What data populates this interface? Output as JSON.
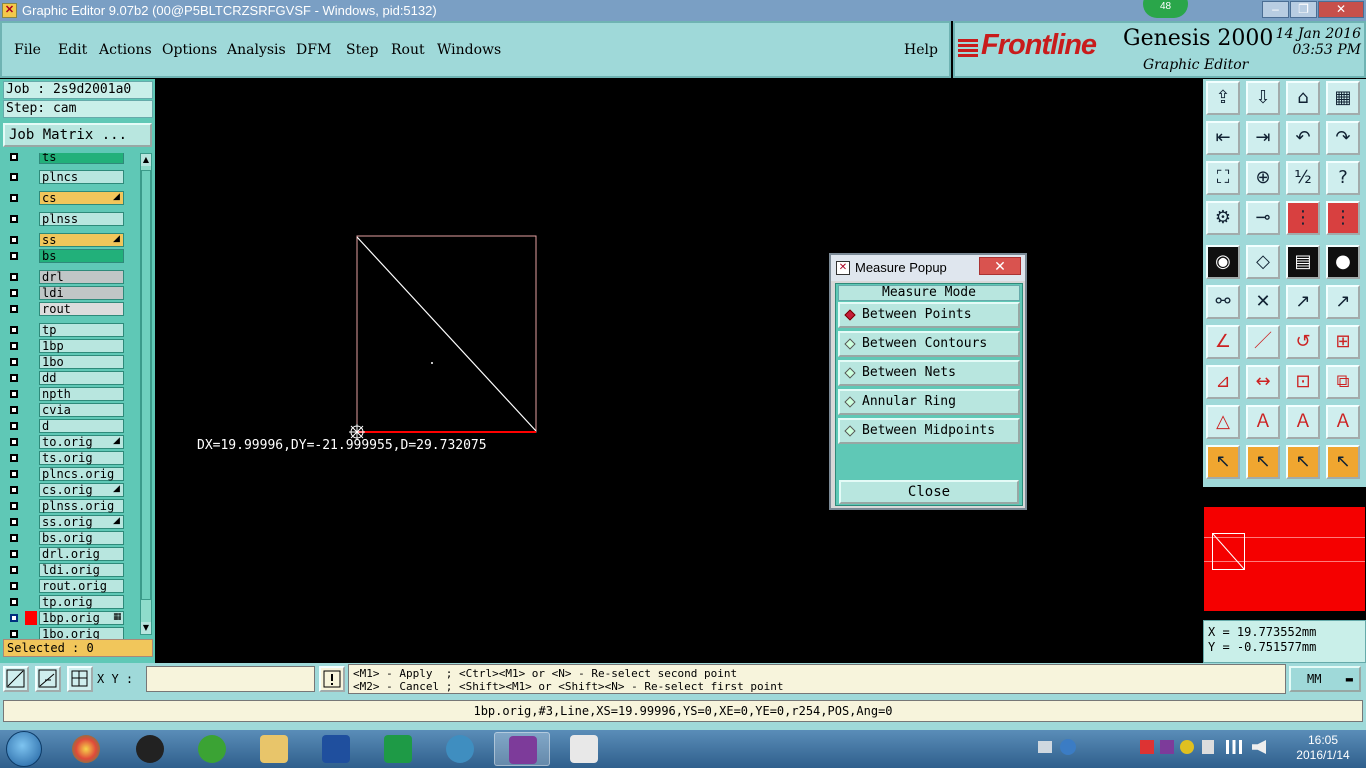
{
  "window": {
    "title": "Graphic Editor 9.07b2 (00@P5BLTCRZSRFGVSF - Windows, pid:5132)",
    "badge": "48",
    "controls": [
      "–",
      "❐",
      "✕"
    ]
  },
  "menu": {
    "items": [
      "File",
      "Edit",
      "Actions",
      "Options",
      "Analysis",
      "DFM",
      "Step",
      "Rout",
      "Windows"
    ],
    "help": "Help"
  },
  "brand": {
    "logo": "Frontline",
    "product": "Genesis 2000",
    "subtitle": "Graphic Editor",
    "date": "14 Jan 2016",
    "time": "03:53 PM"
  },
  "job": {
    "job_line": "Job : 2s9d2001a0",
    "step_line": "Step: cam",
    "matrix_button": "Job Matrix ...",
    "selected": "Selected : 0"
  },
  "layers": [
    {
      "name": "ts",
      "color": "#22b07a"
    },
    {
      "name": "plncs",
      "color": "#b8e6df"
    },
    {
      "name": "cs",
      "color": "#f1c65b"
    },
    {
      "name": "plnss",
      "color": "#b8e6df"
    },
    {
      "name": "ss",
      "color": "#f1c65b"
    },
    {
      "name": "bs",
      "color": "#22b07a"
    },
    {
      "name": "drl",
      "color": "#c0c6c6"
    },
    {
      "name": "ldi",
      "color": "#c0c6c6"
    },
    {
      "name": "rout",
      "color": "#dcdcdc"
    },
    {
      "name": "tp",
      "color": "#b8e6df"
    },
    {
      "name": "1bp",
      "color": "#b8e6df"
    },
    {
      "name": "1bo",
      "color": "#b8e6df"
    },
    {
      "name": "dd",
      "color": "#b8e6df"
    },
    {
      "name": "npth",
      "color": "#b8e6df"
    },
    {
      "name": "cvia",
      "color": "#b8e6df"
    },
    {
      "name": "d",
      "color": "#b8e6df"
    },
    {
      "name": "to.orig",
      "color": "#b8e6df"
    },
    {
      "name": "ts.orig",
      "color": "#b8e6df"
    },
    {
      "name": "plncs.orig",
      "color": "#b8e6df"
    },
    {
      "name": "cs.orig",
      "color": "#b8e6df"
    },
    {
      "name": "plnss.orig",
      "color": "#b8e6df"
    },
    {
      "name": "ss.orig",
      "color": "#b8e6df"
    },
    {
      "name": "bs.orig",
      "color": "#b8e6df"
    },
    {
      "name": "drl.orig",
      "color": "#b8e6df"
    },
    {
      "name": "ldi.orig",
      "color": "#b8e6df"
    },
    {
      "name": "rout.orig",
      "color": "#b8e6df"
    },
    {
      "name": "tp.orig",
      "color": "#b8e6df"
    },
    {
      "name": "1bp.orig",
      "color": "#b8e6df"
    },
    {
      "name": "1bo.orig",
      "color": "#b8e6df"
    }
  ],
  "canvas": {
    "measure_readout": "DX=19.99996,DY=-21.999955,D=29.732075"
  },
  "measure_popup": {
    "title": "Measure Popup",
    "close_x": "✕",
    "mode_header": "Measure Mode",
    "modes": [
      "Between Points",
      "Between Contours",
      "Between Nets",
      "Annular Ring",
      "Between Midpoints"
    ],
    "selected_mode": "Between Points",
    "close_button": "Close"
  },
  "toolbar": {
    "icons": [
      "open-step-icon",
      "save-icon",
      "home-icon",
      "panel-icon",
      "prev-icon",
      "next-icon",
      "undo-icon",
      "redo-icon",
      "zoom-fit-icon",
      "zoom-home-icon",
      "zoom-1to2-icon",
      "help-icon",
      "settings-icon",
      "snap-icon",
      "layers-a-icon",
      "layers-b-icon",
      "pad-icon",
      "rect-icon",
      "ruler-icon",
      "dot-icon",
      "connect-icon",
      "intersect-icon",
      "point-icon",
      "vector-icon",
      "angle-icon",
      "line-icon",
      "arc-icon",
      "fill-icon",
      "rotate-icon",
      "mirror-icon",
      "scale-icon",
      "copy-icon",
      "triangle-icon",
      "text-a-icon",
      "text-b-icon",
      "text-c-icon",
      "select-icon",
      "select-box-icon",
      "select-circle-icon",
      "select-poly-icon"
    ]
  },
  "cursor_coords": {
    "x": "X = 19.773552mm",
    "y": "Y = -0.751577mm"
  },
  "bottom": {
    "xy_label": "X Y :",
    "xy_value": "",
    "hint_line1": "<M1> - Apply  ; <Ctrl><M1> or <N> - Re-select second point",
    "hint_line2": "<M2> - Cancel ; <Shift><M1> or <Shift><N> - Re-select first point",
    "units": "MM",
    "status": "1bp.orig,#3,Line,XS=19.99996,YS=0,XE=0,YE=0,r254,POS,Ang=0"
  },
  "taskbar": {
    "time": "16:05",
    "date": "2016/1/14"
  }
}
